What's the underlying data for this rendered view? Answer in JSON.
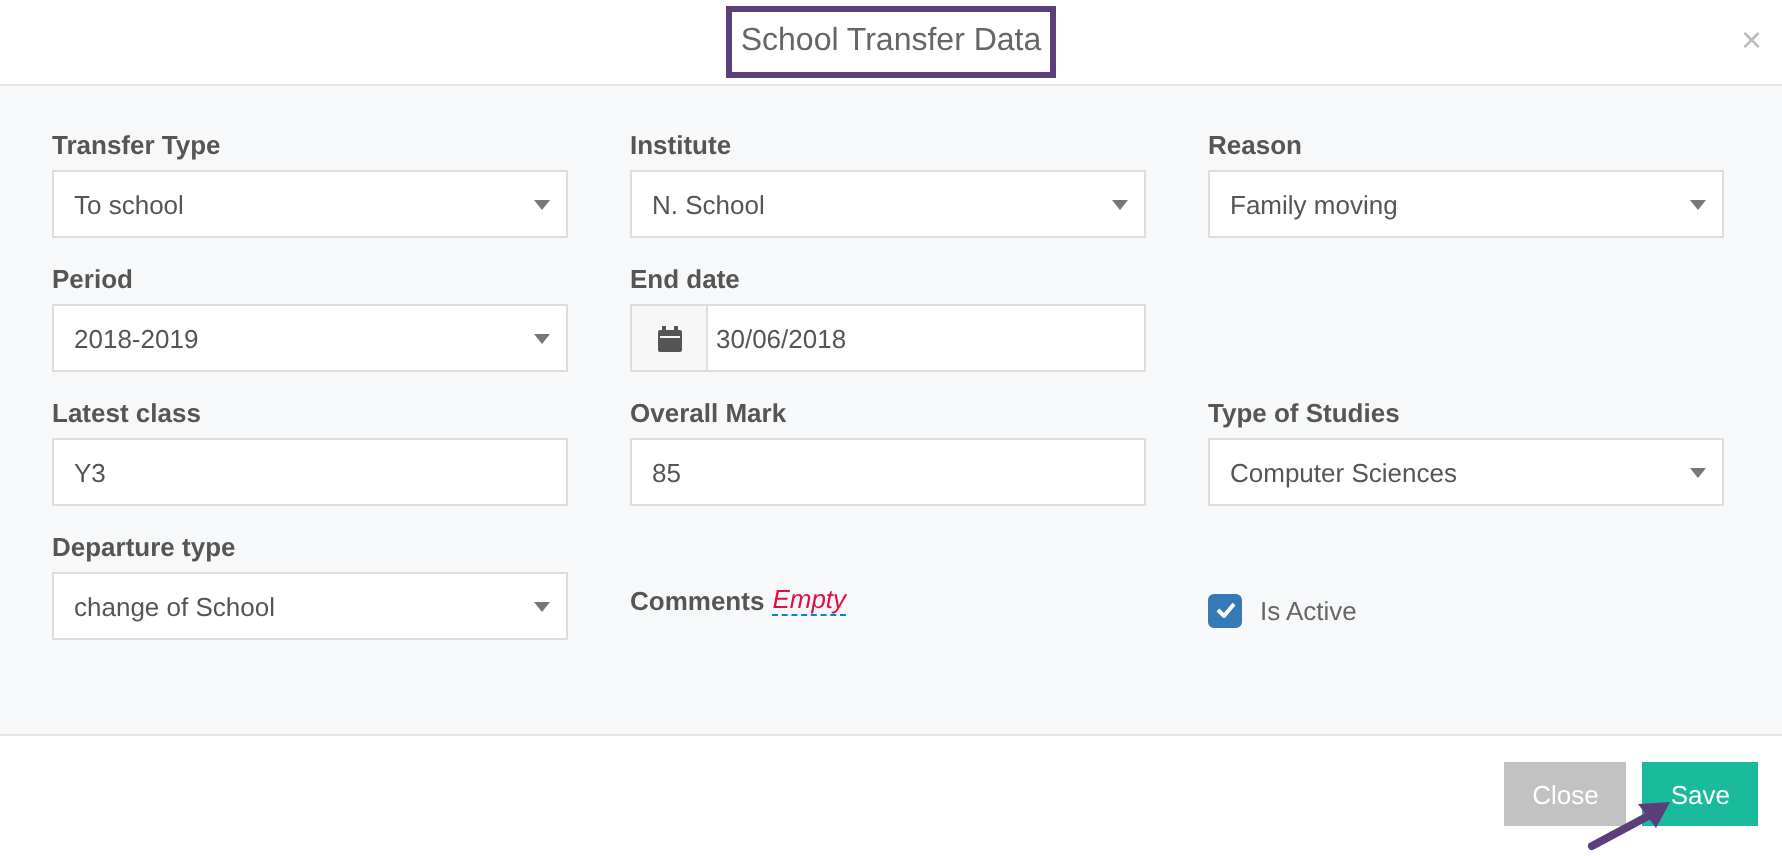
{
  "dialog": {
    "title": "School Transfer Data",
    "title_outlined": true,
    "close_glyph": "×"
  },
  "rows": [
    [
      {
        "kind": "select",
        "label": "Transfer Type",
        "value": "To school"
      },
      {
        "kind": "select",
        "label": "Institute",
        "value": "N. School"
      },
      {
        "kind": "select",
        "label": "Reason",
        "value": "Family moving"
      }
    ],
    [
      {
        "kind": "select",
        "label": "Period",
        "value": "2018-2019"
      },
      {
        "kind": "date",
        "label": "End date",
        "value": "30/06/2018"
      }
    ],
    [
      {
        "kind": "text",
        "label": "Latest class",
        "value": "Y3"
      },
      {
        "kind": "text",
        "label": "Overall Mark",
        "value": "85"
      },
      {
        "kind": "select",
        "label": "Type of Studies",
        "value": "Computer Sciences"
      }
    ],
    [
      {
        "kind": "select",
        "label": "Departure type",
        "value": "change of School"
      },
      {
        "kind": "inline",
        "label": "Comments",
        "value": "Empty"
      },
      {
        "kind": "checkbox",
        "label": "Is Active",
        "checked": true
      }
    ]
  ],
  "buttons": [
    {
      "label": "Close",
      "kind": "secondary"
    },
    {
      "label": "Save",
      "kind": "primary",
      "pointed": true
    }
  ]
}
